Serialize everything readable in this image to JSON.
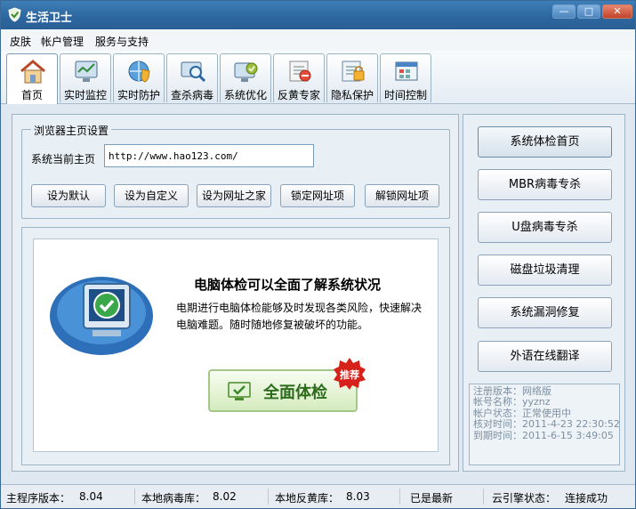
{
  "window": {
    "title": "生活卫士",
    "minimize": "—",
    "maximize": "□",
    "close": "✕"
  },
  "menu": [
    "皮肤",
    "帐户管理",
    "服务与支持"
  ],
  "tabs": [
    {
      "label": "首页",
      "icon": "home-icon"
    },
    {
      "label": "实时监控",
      "icon": "monitor-icon"
    },
    {
      "label": "实时防护",
      "icon": "shield-globe-icon"
    },
    {
      "label": "查杀病毒",
      "icon": "virus-scan-icon"
    },
    {
      "label": "系统优化",
      "icon": "system-optimize-icon"
    },
    {
      "label": "反黄专家",
      "icon": "filter-expert-icon"
    },
    {
      "label": "隐私保护",
      "icon": "privacy-icon"
    },
    {
      "label": "时间控制",
      "icon": "time-control-icon"
    }
  ],
  "homepage": {
    "group_title": "浏览器主页设置",
    "current_label": "系统当前主页",
    "url_value": "http://www.hao123.com/",
    "buttons": [
      "设为默认",
      "设为自定义",
      "设为网址之家",
      "锁定网址项",
      "解锁网址项"
    ]
  },
  "promo": {
    "title": "电脑体检可以全面了解系统状况",
    "desc": "电期进行电脑体检能够及时发现各类风险，快速解决电脑难题。随时随地修复被破坏的功能。",
    "button": "全面体检",
    "badge": "推荐"
  },
  "side_buttons": [
    "系统体检首页",
    "MBR病毒专杀",
    "U盘病毒专杀",
    "磁盘垃圾清理",
    "系统漏洞修复",
    "外语在线翻译"
  ],
  "account_info": [
    "注册版本：网络版",
    "帐号名称：yyznz",
    "帐户状态：正常使用中",
    "核对时间：2011-4-23 22:30:52",
    "到期时间：2011-6-15 3:49:05"
  ],
  "status": {
    "version_label": "主程序版本：",
    "version": "8.04",
    "virus_db_label": "本地病毒库：",
    "virus_db": "8.02",
    "filter_db_label": "本地反黄库：",
    "filter_db": "8.03",
    "latest": "已是最新",
    "cloud_label": "云引擎状态：",
    "cloud": "连接成功"
  },
  "colors": {
    "titlebar": "#2c669e",
    "accent_green": "#2d6b1c",
    "badge_red": "#d6221b"
  }
}
